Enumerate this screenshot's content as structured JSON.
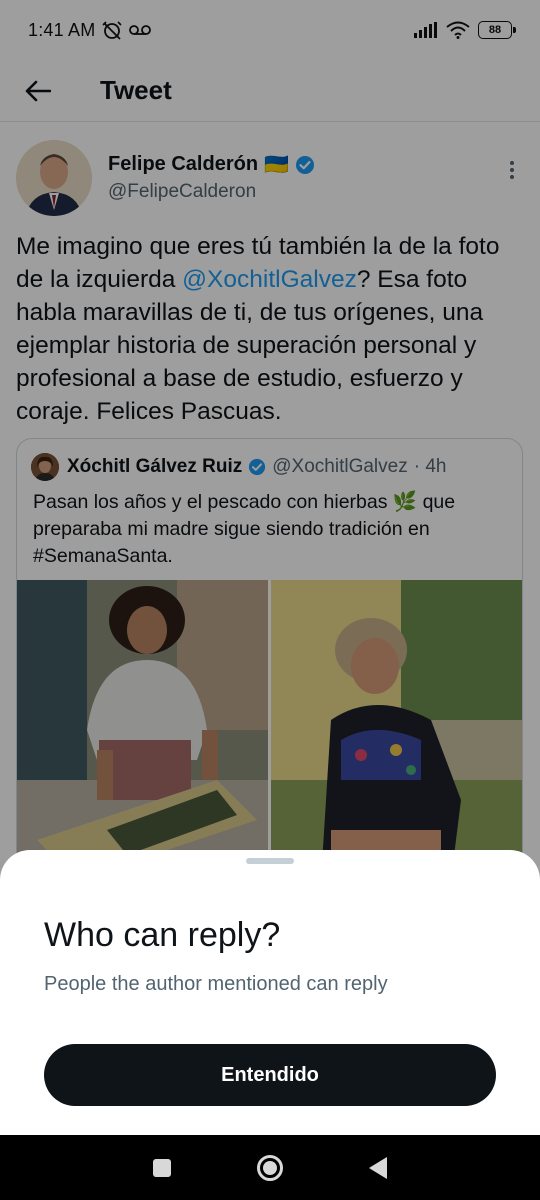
{
  "status_bar": {
    "time": "1:41 AM",
    "battery": "88"
  },
  "header": {
    "title": "Tweet"
  },
  "tweet": {
    "author_name": "Felipe Calderón",
    "flag_emoji": "🇺🇦",
    "author_handle": "@FelipeCalderon",
    "text_before": "Me imagino que eres tú también la de la foto de la izquierda ",
    "mention": "@XochitlGalvez",
    "text_after": "? Esa foto habla maravillas de ti, de tus orígenes, una ejemplar historia de superación personal y profesional a base de estudio, esfuerzo y coraje. Felices Pascuas."
  },
  "quoted_tweet": {
    "author_name": "Xóchitl Gálvez Ruiz",
    "author_handle": "@XochitlGalvez",
    "time_ago": "· 4h",
    "text": "Pasan los años y el pescado con hierbas 🌿 que preparaba mi madre sigue siendo tradición en #SemanaSanta."
  },
  "sheet": {
    "title": "Who can reply?",
    "description": "People the author mentioned can reply",
    "button_label": "Entendido"
  },
  "colors": {
    "accent": "#1d9bf0",
    "text": "#0f1419",
    "secondary_text": "#536471",
    "button_bg": "#0f1419"
  }
}
